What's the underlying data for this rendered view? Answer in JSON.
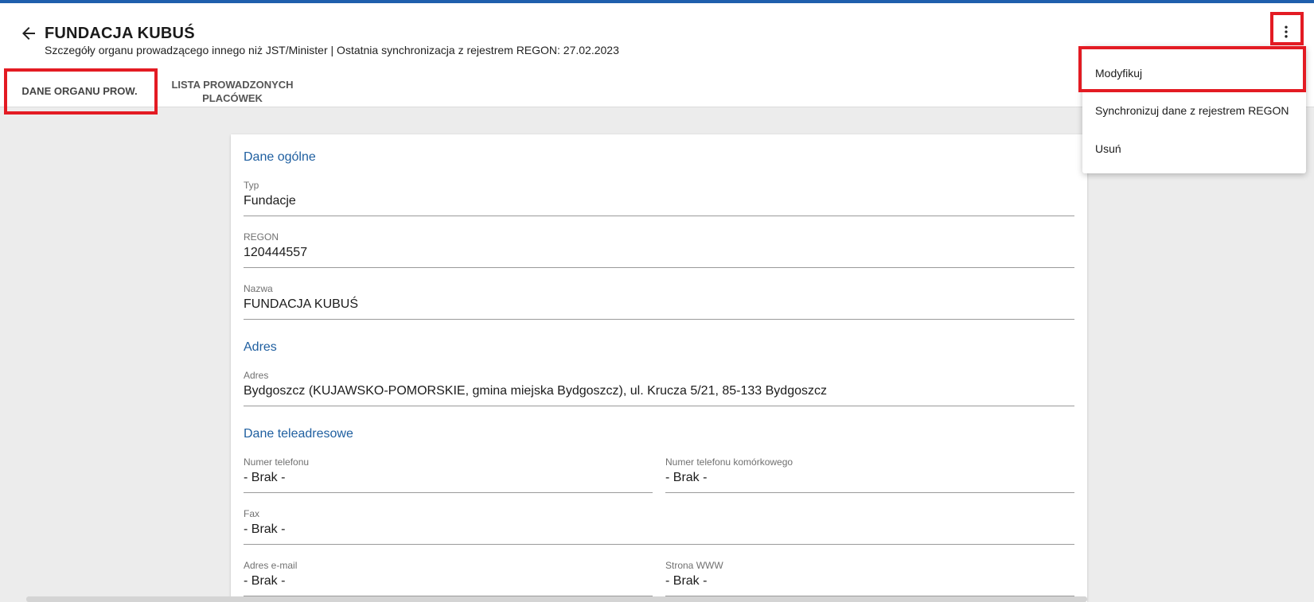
{
  "header": {
    "title": "FUNDACJA KUBUŚ",
    "subtitle": "Szczegóły organu prowadzącego innego niż JST/Minister | Ostatnia synchronizacja z rejestrem REGON: 27.02.2023",
    "back_icon": "arrow-left-icon",
    "more_icon": "more-vertical-icon"
  },
  "tabs": [
    {
      "label": "DANE ORGANU PROW.",
      "active": true
    },
    {
      "label": "LISTA PROWADZONYCH PLACÓWEK",
      "active": false
    }
  ],
  "menu": {
    "items": [
      {
        "label": "Modyfikuj"
      },
      {
        "label": "Synchronizuj dane z rejestrem REGON"
      },
      {
        "label": "Usuń"
      }
    ]
  },
  "sections": {
    "general": {
      "title": "Dane ogólne",
      "typ": {
        "label": "Typ",
        "value": "Fundacje"
      },
      "regon": {
        "label": "REGON",
        "value": "120444557"
      },
      "nazwa": {
        "label": "Nazwa",
        "value": "FUNDACJA KUBUŚ"
      }
    },
    "address": {
      "title": "Adres",
      "adres": {
        "label": "Adres",
        "value": "Bydgoszcz (KUJAWSKO-POMORSKIE, gmina miejska Bydgoszcz), ul. Krucza 5/21, 85-133 Bydgoszcz"
      }
    },
    "contact": {
      "title": "Dane teleadresowe",
      "phone": {
        "label": "Numer telefonu",
        "value": "- Brak -"
      },
      "mobile": {
        "label": "Numer telefonu komórkowego",
        "value": "- Brak -"
      },
      "fax": {
        "label": "Fax",
        "value": "- Brak -"
      },
      "email": {
        "label": "Adres e-mail",
        "value": "- Brak -"
      },
      "www": {
        "label": "Strona WWW",
        "value": "- Brak -"
      }
    }
  },
  "colors": {
    "accent": "#1f5fad",
    "section_title": "#1f5fa0",
    "highlight": "#e31b23",
    "background": "#ececec"
  }
}
